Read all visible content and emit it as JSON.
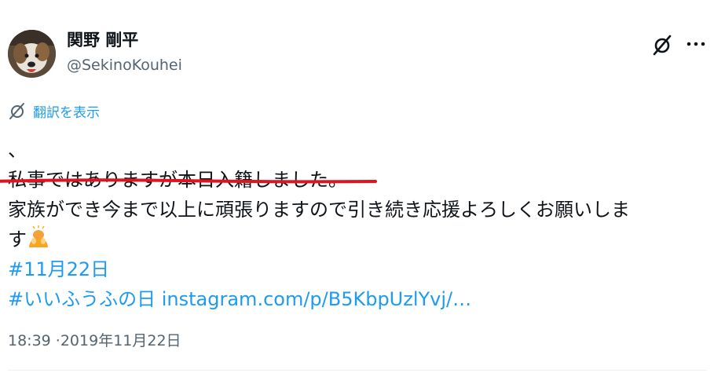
{
  "author": {
    "name": "関野 剛平",
    "handle": "@SekinoKouhei"
  },
  "icons": {
    "avatar": "dog-avatar",
    "grok": "grok-icon",
    "more": "more-icon",
    "translate": "grok-icon",
    "emoji": "person-bowing-emoji"
  },
  "translate_label": "翻訳を表示",
  "tweet": {
    "line1": "、",
    "line2": "私事ではありますが本日入籍しました。",
    "line3": "家族ができ今まで以上に頑張りますので引き続き応援よろしくお願いしま",
    "line4": "す",
    "hashtag1": "#11月22日",
    "hashtag2": "#いいふうふの日",
    "link": "instagram.com/p/B5KbpUzlYvj/…"
  },
  "timestamp": "18:39 ·2019年11月22日",
  "colors": {
    "link": "#1d9bf0",
    "annotation_underline": "#e0131f",
    "secondary_text": "#536471"
  }
}
